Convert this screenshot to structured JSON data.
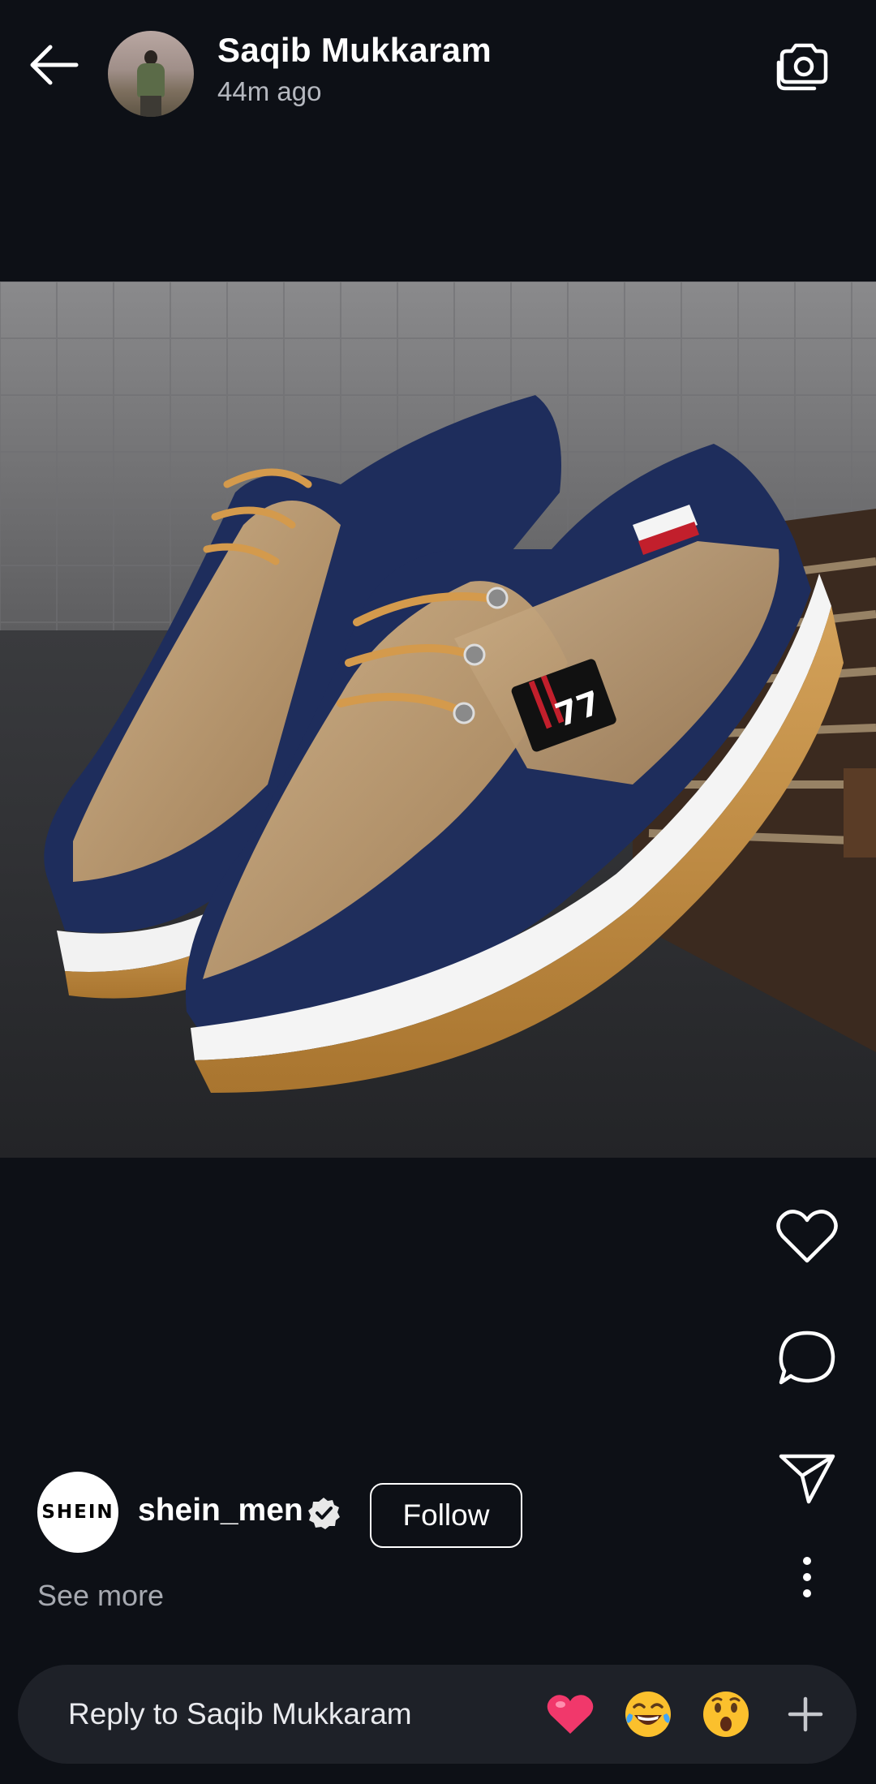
{
  "header": {
    "user_name": "Saqib Mukkaram",
    "time_ago": "44m ago",
    "icons": {
      "back": "back-arrow-icon",
      "camera": "camera-switch-icon"
    }
  },
  "post": {
    "image_subject": "shoes-photo"
  },
  "actions": {
    "icons": [
      "heart-icon",
      "comment-icon",
      "send-icon",
      "more-vertical-icon"
    ]
  },
  "account": {
    "logo_text": "SHEIN",
    "name": "shein_men",
    "verified": true,
    "follow_label": "Follow",
    "see_more_label": "See more"
  },
  "reply": {
    "placeholder": "Reply to Saqib Mukkaram",
    "quick_reactions": [
      "heart-emoji",
      "laughing-emoji",
      "surprised-emoji"
    ],
    "add_icon": "plus-icon"
  },
  "colors": {
    "background": "#0d1016",
    "reply_bar": "#1e2128",
    "text_secondary": "#b5b8bf"
  }
}
